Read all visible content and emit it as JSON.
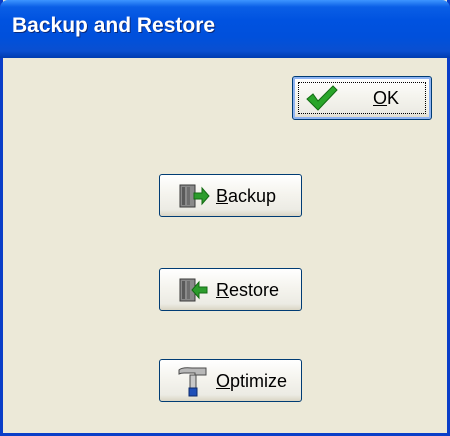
{
  "window": {
    "title": "Backup and Restore"
  },
  "buttons": {
    "ok": {
      "mnemonic": "O",
      "rest": "K",
      "icon": "checkmark-icon"
    },
    "backup": {
      "mnemonic": "B",
      "rest": "ackup",
      "icon": "backup-icon"
    },
    "restore": {
      "mnemonic": "R",
      "rest": "estore",
      "icon": "restore-icon"
    },
    "optimize": {
      "mnemonic": "O",
      "rest": "ptimize",
      "icon": "hammer-icon"
    }
  },
  "colors": {
    "titlebar": "#0052e0",
    "dialog_background": "#ece9d8",
    "checkmark": "#2aa52a",
    "arrow": "#2c9c2c"
  }
}
